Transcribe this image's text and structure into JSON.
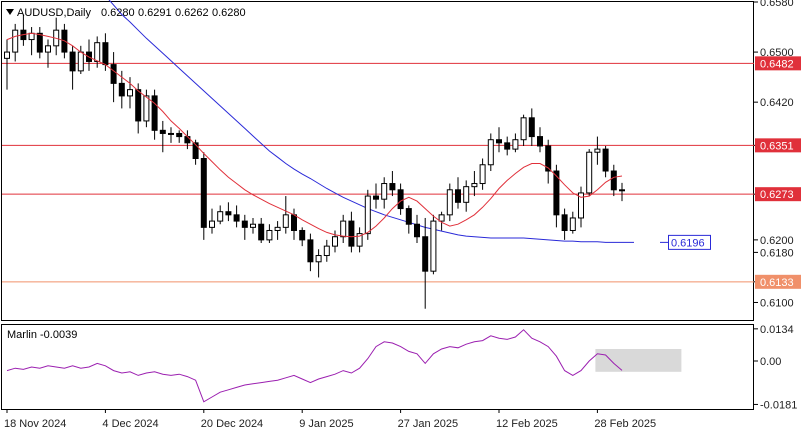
{
  "header": {
    "symbol": "AUDUSD,Daily",
    "open": "0.6280",
    "high": "0.6291",
    "low": "0.6262",
    "close": "0.6280"
  },
  "colors": {
    "bull": "#ffffff",
    "bear": "#000000",
    "ma_fast": "#e0303a",
    "ma_slow": "#2a2ad8",
    "hline": "#e0303a",
    "hline_light": "#f0906a",
    "oscillator": "#9b1fb0",
    "label_red": "#e0303a",
    "label_blue": "#2a2ad8"
  },
  "chart_data": [
    {
      "type": "candlestick",
      "price_range": [
        0.6072,
        0.658
      ],
      "y_ticks": [
        "0.6580",
        "0.6500",
        "0.6420",
        "0.6351",
        "0.6273",
        "0.6200",
        "0.6180",
        "0.6133",
        "0.6100"
      ],
      "x_labels": [
        "18 Nov 2024",
        "4 Dec 2024",
        "20 Dec 2024",
        "9 Jan 2025",
        "27 Jan 2025",
        "12 Feb 2025",
        "28 Feb 2025"
      ],
      "x_label_index": [
        0,
        12,
        24,
        36,
        48,
        60,
        72
      ],
      "candles": [
        [
          0.649,
          0.652,
          0.644,
          0.65
        ],
        [
          0.65,
          0.6545,
          0.6485,
          0.6535
        ],
        [
          0.6535,
          0.656,
          0.651,
          0.652
        ],
        [
          0.652,
          0.654,
          0.6495,
          0.653
        ],
        [
          0.653,
          0.654,
          0.649,
          0.65
        ],
        [
          0.65,
          0.652,
          0.6475,
          0.651
        ],
        [
          0.651,
          0.6555,
          0.6495,
          0.6535
        ],
        [
          0.6535,
          0.6545,
          0.649,
          0.65
        ],
        [
          0.65,
          0.651,
          0.644,
          0.647
        ],
        [
          0.647,
          0.651,
          0.6465,
          0.65
        ],
        [
          0.65,
          0.652,
          0.647,
          0.6485
        ],
        [
          0.6485,
          0.6525,
          0.6475,
          0.6515
        ],
        [
          0.6515,
          0.653,
          0.647,
          0.648
        ],
        [
          0.648,
          0.65,
          0.642,
          0.645
        ],
        [
          0.645,
          0.647,
          0.641,
          0.643
        ],
        [
          0.643,
          0.646,
          0.641,
          0.644
        ],
        [
          0.644,
          0.645,
          0.637,
          0.639
        ],
        [
          0.639,
          0.644,
          0.638,
          0.643
        ],
        [
          0.643,
          0.644,
          0.636,
          0.6375
        ],
        [
          0.6375,
          0.639,
          0.634,
          0.637
        ],
        [
          0.637,
          0.638,
          0.6355,
          0.637
        ],
        [
          0.637,
          0.6375,
          0.6355,
          0.6365
        ],
        [
          0.6365,
          0.6375,
          0.6345,
          0.6355
        ],
        [
          0.6355,
          0.636,
          0.632,
          0.633
        ],
        [
          0.633,
          0.634,
          0.62,
          0.622
        ],
        [
          0.622,
          0.625,
          0.621,
          0.623
        ],
        [
          0.623,
          0.6255,
          0.6225,
          0.6245
        ],
        [
          0.6245,
          0.626,
          0.623,
          0.624
        ],
        [
          0.624,
          0.6255,
          0.622,
          0.623
        ],
        [
          0.623,
          0.624,
          0.62,
          0.622
        ],
        [
          0.622,
          0.6235,
          0.621,
          0.6225
        ],
        [
          0.6225,
          0.6235,
          0.6195,
          0.62
        ],
        [
          0.62,
          0.6225,
          0.6195,
          0.6215
        ],
        [
          0.6215,
          0.623,
          0.62,
          0.622
        ],
        [
          0.622,
          0.627,
          0.621,
          0.624
        ],
        [
          0.624,
          0.625,
          0.62,
          0.6215
        ],
        [
          0.6215,
          0.622,
          0.619,
          0.62
        ],
        [
          0.62,
          0.621,
          0.615,
          0.6165
        ],
        [
          0.6165,
          0.6185,
          0.614,
          0.6175
        ],
        [
          0.6175,
          0.62,
          0.6165,
          0.619
        ],
        [
          0.619,
          0.6215,
          0.618,
          0.6205
        ],
        [
          0.6205,
          0.624,
          0.6195,
          0.623
        ],
        [
          0.623,
          0.6245,
          0.618,
          0.619
        ],
        [
          0.619,
          0.622,
          0.618,
          0.621
        ],
        [
          0.621,
          0.628,
          0.62,
          0.627
        ],
        [
          0.627,
          0.629,
          0.625,
          0.6265
        ],
        [
          0.6265,
          0.63,
          0.625,
          0.629
        ],
        [
          0.629,
          0.631,
          0.627,
          0.628
        ],
        [
          0.628,
          0.629,
          0.624,
          0.625
        ],
        [
          0.625,
          0.6255,
          0.621,
          0.6225
        ],
        [
          0.6225,
          0.624,
          0.6195,
          0.6205
        ],
        [
          0.6205,
          0.6235,
          0.609,
          0.615
        ],
        [
          0.615,
          0.624,
          0.6145,
          0.623
        ],
        [
          0.623,
          0.6245,
          0.6215,
          0.624
        ],
        [
          0.624,
          0.629,
          0.623,
          0.628
        ],
        [
          0.628,
          0.63,
          0.625,
          0.626
        ],
        [
          0.626,
          0.6295,
          0.6245,
          0.6285
        ],
        [
          0.6285,
          0.631,
          0.627,
          0.629
        ],
        [
          0.629,
          0.633,
          0.628,
          0.632
        ],
        [
          0.632,
          0.637,
          0.631,
          0.636
        ],
        [
          0.636,
          0.638,
          0.634,
          0.6355
        ],
        [
          0.6355,
          0.6365,
          0.6335,
          0.6345
        ],
        [
          0.6345,
          0.637,
          0.634,
          0.636
        ],
        [
          0.636,
          0.64,
          0.635,
          0.6395
        ],
        [
          0.6395,
          0.641,
          0.635,
          0.6365
        ],
        [
          0.6365,
          0.638,
          0.634,
          0.635
        ],
        [
          0.635,
          0.636,
          0.629,
          0.631
        ],
        [
          0.631,
          0.632,
          0.622,
          0.624
        ],
        [
          0.624,
          0.625,
          0.62,
          0.6215
        ],
        [
          0.6215,
          0.6245,
          0.621,
          0.6235
        ],
        [
          0.6235,
          0.6285,
          0.622,
          0.6275
        ],
        [
          0.6275,
          0.6345,
          0.627,
          0.634
        ],
        [
          0.634,
          0.6365,
          0.632,
          0.6345
        ],
        [
          0.6345,
          0.635,
          0.63,
          0.631
        ],
        [
          0.631,
          0.632,
          0.627,
          0.628
        ],
        [
          0.628,
          0.6291,
          0.6262,
          0.628
        ]
      ],
      "ma_fast": [
        0.652,
        0.6525,
        0.6528,
        0.653,
        0.6528,
        0.6525,
        0.6522,
        0.6518,
        0.651,
        0.65,
        0.6492,
        0.6486,
        0.648,
        0.647,
        0.646,
        0.645,
        0.6438,
        0.6428,
        0.6418,
        0.6405,
        0.639,
        0.6378,
        0.6365,
        0.6352,
        0.6338,
        0.6325,
        0.6312,
        0.63,
        0.629,
        0.628,
        0.6272,
        0.6265,
        0.6258,
        0.6252,
        0.6246,
        0.624,
        0.6232,
        0.6225,
        0.6218,
        0.6212,
        0.6208,
        0.6206,
        0.6205,
        0.6206,
        0.6212,
        0.6222,
        0.6235,
        0.625,
        0.6262,
        0.6268,
        0.6262,
        0.625,
        0.6238,
        0.6228,
        0.6222,
        0.6225,
        0.6232,
        0.624,
        0.6252,
        0.6266,
        0.6282,
        0.6295,
        0.6306,
        0.6316,
        0.6322,
        0.6322,
        0.6315,
        0.6302,
        0.6288,
        0.6275,
        0.6268,
        0.627,
        0.628,
        0.6292,
        0.63,
        0.6302
      ],
      "ma_slow": [
        null,
        null,
        null,
        null,
        null,
        null,
        null,
        null,
        null,
        null,
        null,
        null,
        0.659,
        0.6575,
        0.656,
        0.6548,
        0.6535,
        0.6522,
        0.651,
        0.6498,
        0.6486,
        0.6474,
        0.6462,
        0.645,
        0.6438,
        0.6426,
        0.6414,
        0.6402,
        0.639,
        0.6378,
        0.6366,
        0.6354,
        0.6342,
        0.6332,
        0.6322,
        0.6313,
        0.6305,
        0.6298,
        0.629,
        0.6282,
        0.6275,
        0.6268,
        0.6262,
        0.6256,
        0.625,
        0.6245,
        0.624,
        0.6236,
        0.6232,
        0.6228,
        0.6224,
        0.622,
        0.6217,
        0.6214,
        0.6211,
        0.6208,
        0.6206,
        0.6205,
        0.6204,
        0.6203,
        0.6203,
        0.6203,
        0.6203,
        0.6203,
        0.6202,
        0.6201,
        0.62,
        0.6199,
        0.6198,
        0.6198,
        0.6197,
        0.6197,
        0.6197,
        0.6196,
        0.6196,
        0.6196
      ],
      "levels": [
        {
          "price": 0.6482,
          "label": "0.6482",
          "style": "red"
        },
        {
          "price": 0.6351,
          "label": "0.6351",
          "style": "red"
        },
        {
          "price": 0.6273,
          "label": "0.6273",
          "style": "red"
        },
        {
          "price": 0.6133,
          "label": "0.6133",
          "style": "light"
        }
      ],
      "callout": {
        "price": 0.6196,
        "label": "0.6196"
      }
    },
    {
      "type": "line",
      "title": "Marlin -0.0039",
      "y_range": [
        -0.02,
        0.015
      ],
      "y_ticks": [
        {
          "value": 0.0134,
          "label": "0.0134"
        },
        {
          "value": 0.0,
          "label": "0.00"
        },
        {
          "value": -0.0181,
          "label": "-0.0181"
        }
      ],
      "values": [
        -0.004,
        -0.003,
        -0.0035,
        -0.0025,
        -0.003,
        -0.002,
        -0.0025,
        -0.003,
        -0.002,
        -0.003,
        -0.0025,
        -0.001,
        -0.002,
        -0.004,
        -0.005,
        -0.0045,
        -0.006,
        -0.005,
        -0.0045,
        -0.0055,
        -0.006,
        -0.0055,
        -0.0065,
        -0.008,
        -0.017,
        -0.015,
        -0.013,
        -0.012,
        -0.011,
        -0.01,
        -0.0095,
        -0.009,
        -0.0085,
        -0.008,
        -0.007,
        -0.006,
        -0.0075,
        -0.009,
        -0.0075,
        -0.0065,
        -0.0055,
        -0.004,
        -0.005,
        -0.003,
        0.001,
        0.006,
        0.008,
        0.0075,
        0.006,
        0.004,
        0.003,
        -0.001,
        0.003,
        0.005,
        0.006,
        0.0055,
        0.007,
        0.008,
        0.0085,
        0.0105,
        0.0095,
        0.009,
        0.01,
        0.013,
        0.0095,
        0.008,
        0.006,
        0.002,
        -0.004,
        -0.006,
        -0.004,
        0.0,
        0.003,
        0.0025,
        -0.001,
        -0.0039
      ],
      "shaded_box": {
        "from_index": 72,
        "to_index": 82,
        "y_top": 0.005,
        "y_bottom": -0.0045
      }
    }
  ]
}
